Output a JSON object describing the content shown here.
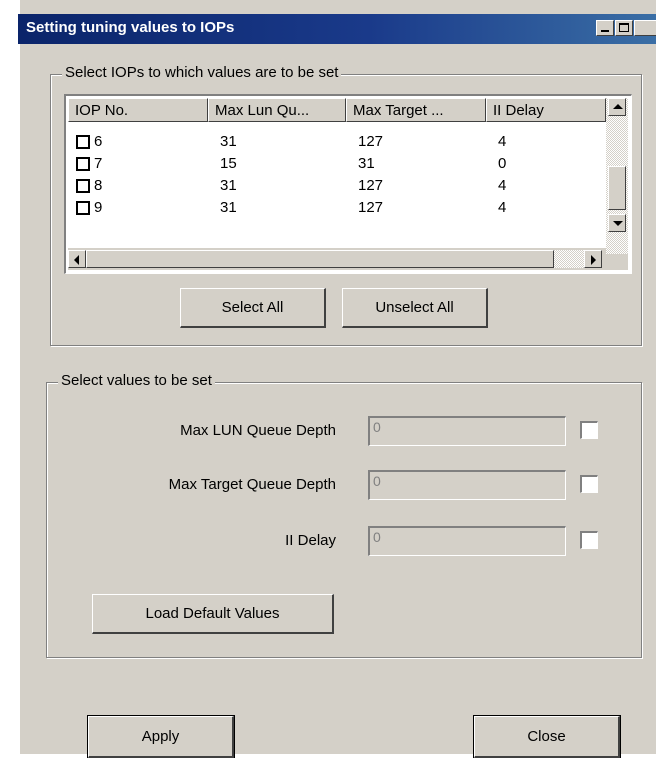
{
  "window": {
    "title": "Setting tuning values to IOPs"
  },
  "iop_group": {
    "legend": "Select IOPs to which values are to be set",
    "columns": [
      "IOP No.",
      "Max Lun Qu...",
      "Max Target ...",
      "II Delay"
    ],
    "rows": [
      {
        "iop": "6",
        "max_lun": "31",
        "max_target": "127",
        "delay": "4"
      },
      {
        "iop": "7",
        "max_lun": "15",
        "max_target": "31",
        "delay": "0"
      },
      {
        "iop": "8",
        "max_lun": "31",
        "max_target": "127",
        "delay": "4"
      },
      {
        "iop": "9",
        "max_lun": "31",
        "max_target": "127",
        "delay": "4"
      }
    ],
    "select_all": "Select All",
    "unselect_all": "Unselect All"
  },
  "values_group": {
    "legend": "Select values to be set",
    "max_lun_label": "Max LUN Queue Depth",
    "max_lun_value": "0",
    "max_target_label": "Max Target Queue Depth",
    "max_target_value": "0",
    "ii_delay_label": "II Delay",
    "ii_delay_value": "0",
    "load_defaults": "Load Default Values"
  },
  "footer": {
    "apply": "Apply",
    "close": "Close"
  }
}
